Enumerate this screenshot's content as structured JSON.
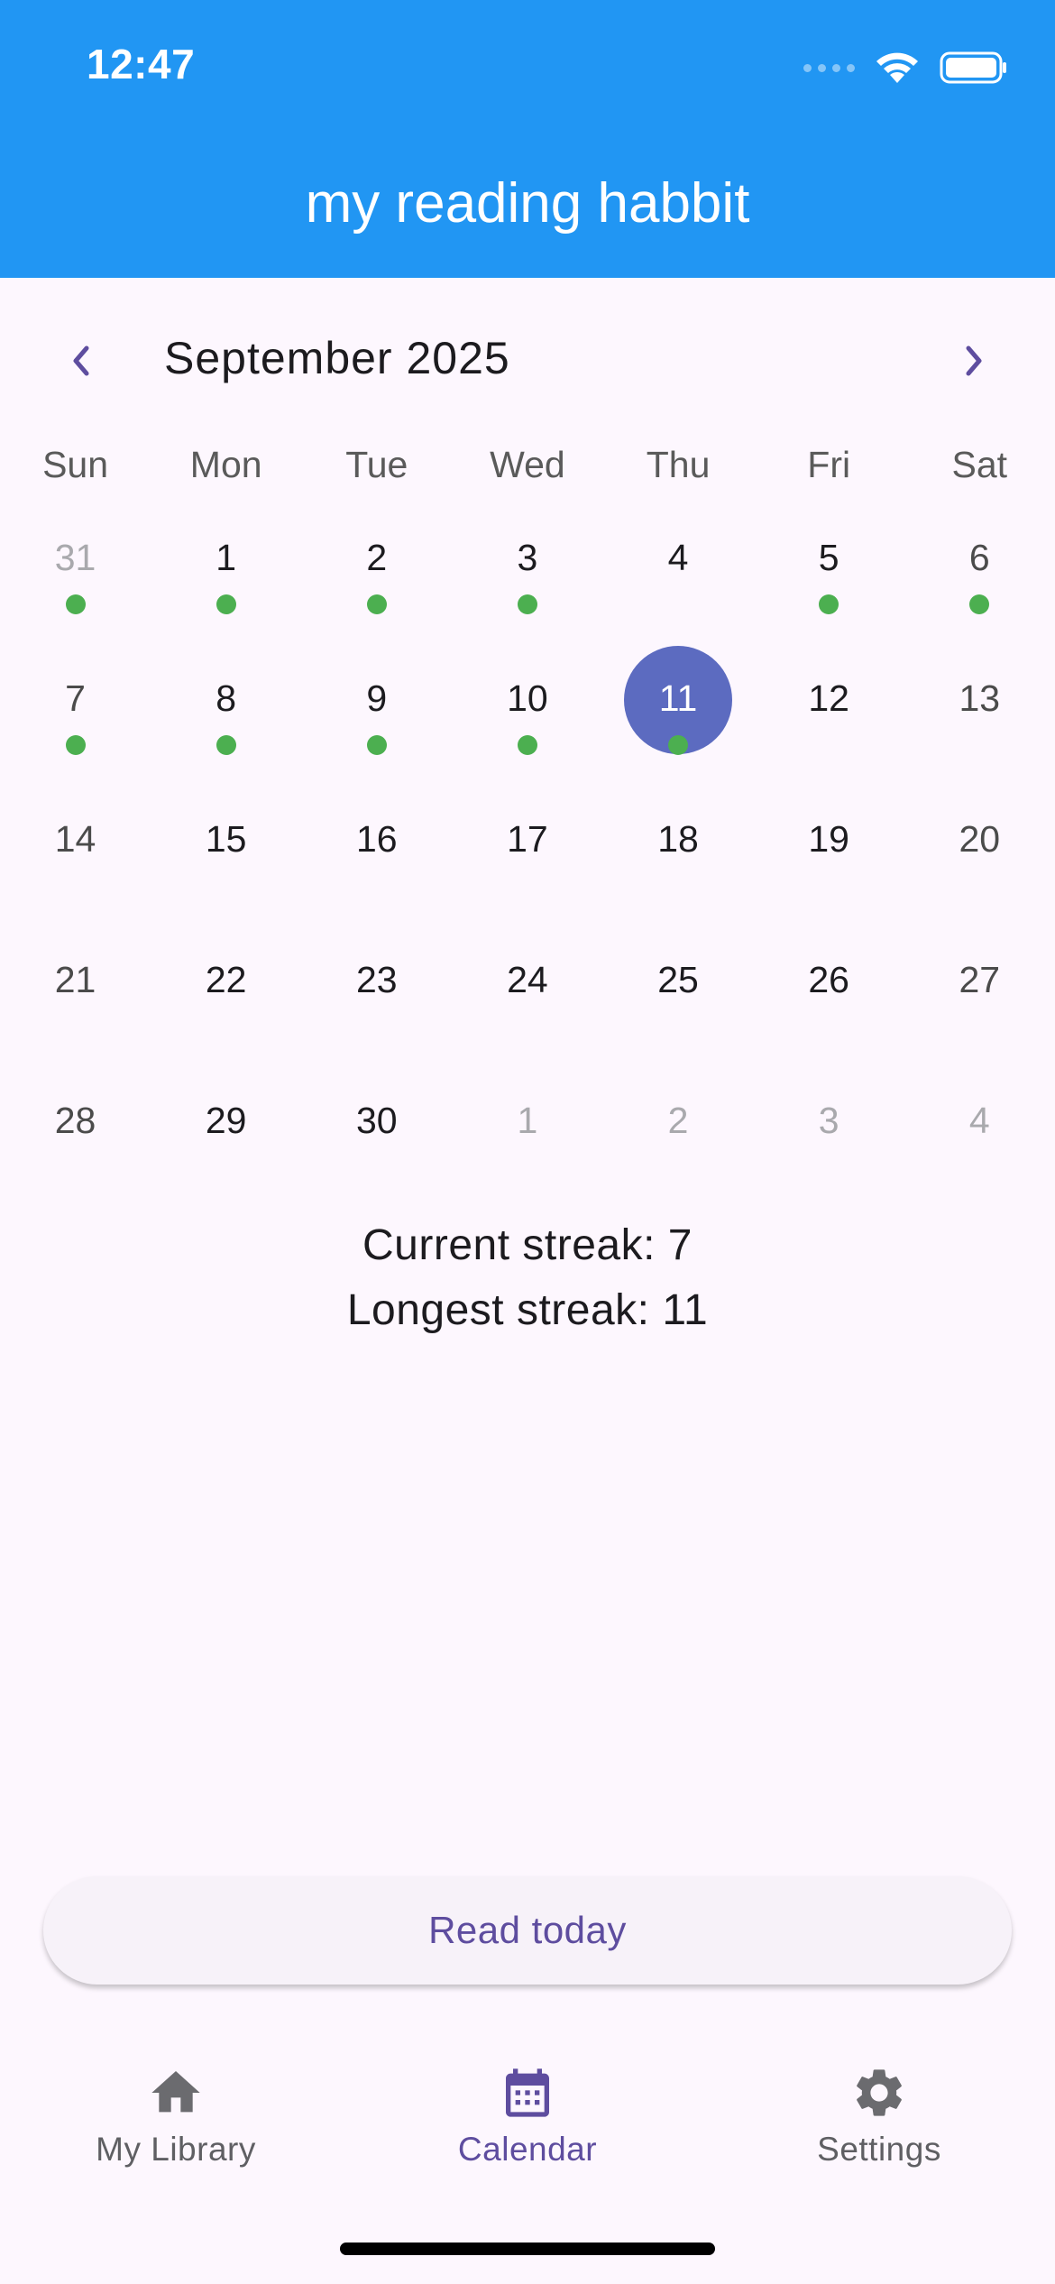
{
  "status_bar": {
    "time": "12:47"
  },
  "app_bar": {
    "title": "my reading habbit"
  },
  "calendar": {
    "month_title": "September 2025",
    "weekdays": [
      "Sun",
      "Mon",
      "Tue",
      "Wed",
      "Thu",
      "Fri",
      "Sat"
    ],
    "weeks": [
      [
        {
          "d": "31",
          "outside": true,
          "dot": true
        },
        {
          "d": "1",
          "dot": true
        },
        {
          "d": "2",
          "dot": true
        },
        {
          "d": "3",
          "dot": true
        },
        {
          "d": "4"
        },
        {
          "d": "5",
          "dot": true
        },
        {
          "d": "6",
          "dot": true
        }
      ],
      [
        {
          "d": "7",
          "dot": true
        },
        {
          "d": "8",
          "dot": true
        },
        {
          "d": "9",
          "dot": true
        },
        {
          "d": "10",
          "dot": true
        },
        {
          "d": "11",
          "selected": true,
          "dot": true
        },
        {
          "d": "12"
        },
        {
          "d": "13"
        }
      ],
      [
        {
          "d": "14"
        },
        {
          "d": "15"
        },
        {
          "d": "16"
        },
        {
          "d": "17"
        },
        {
          "d": "18"
        },
        {
          "d": "19"
        },
        {
          "d": "20"
        }
      ],
      [
        {
          "d": "21"
        },
        {
          "d": "22"
        },
        {
          "d": "23"
        },
        {
          "d": "24"
        },
        {
          "d": "25"
        },
        {
          "d": "26"
        },
        {
          "d": "27"
        }
      ],
      [
        {
          "d": "28"
        },
        {
          "d": "29"
        },
        {
          "d": "30"
        },
        {
          "d": "1",
          "outside": true
        },
        {
          "d": "2",
          "outside": true
        },
        {
          "d": "3",
          "outside": true
        },
        {
          "d": "4",
          "outside": true
        }
      ]
    ]
  },
  "streaks": {
    "current": "Current streak: 7",
    "longest": "Longest streak: 11"
  },
  "read_button": {
    "label": "Read today"
  },
  "bottom_nav": {
    "items": [
      {
        "label": "My Library",
        "icon": "home-icon"
      },
      {
        "label": "Calendar",
        "icon": "calendar-icon",
        "active": true
      },
      {
        "label": "Settings",
        "icon": "gear-icon"
      }
    ]
  },
  "colors": {
    "app_bar": "#2196f3",
    "selected_day": "#5c6bc0",
    "read_dot": "#4caf50",
    "accent": "#5e4d9f"
  }
}
